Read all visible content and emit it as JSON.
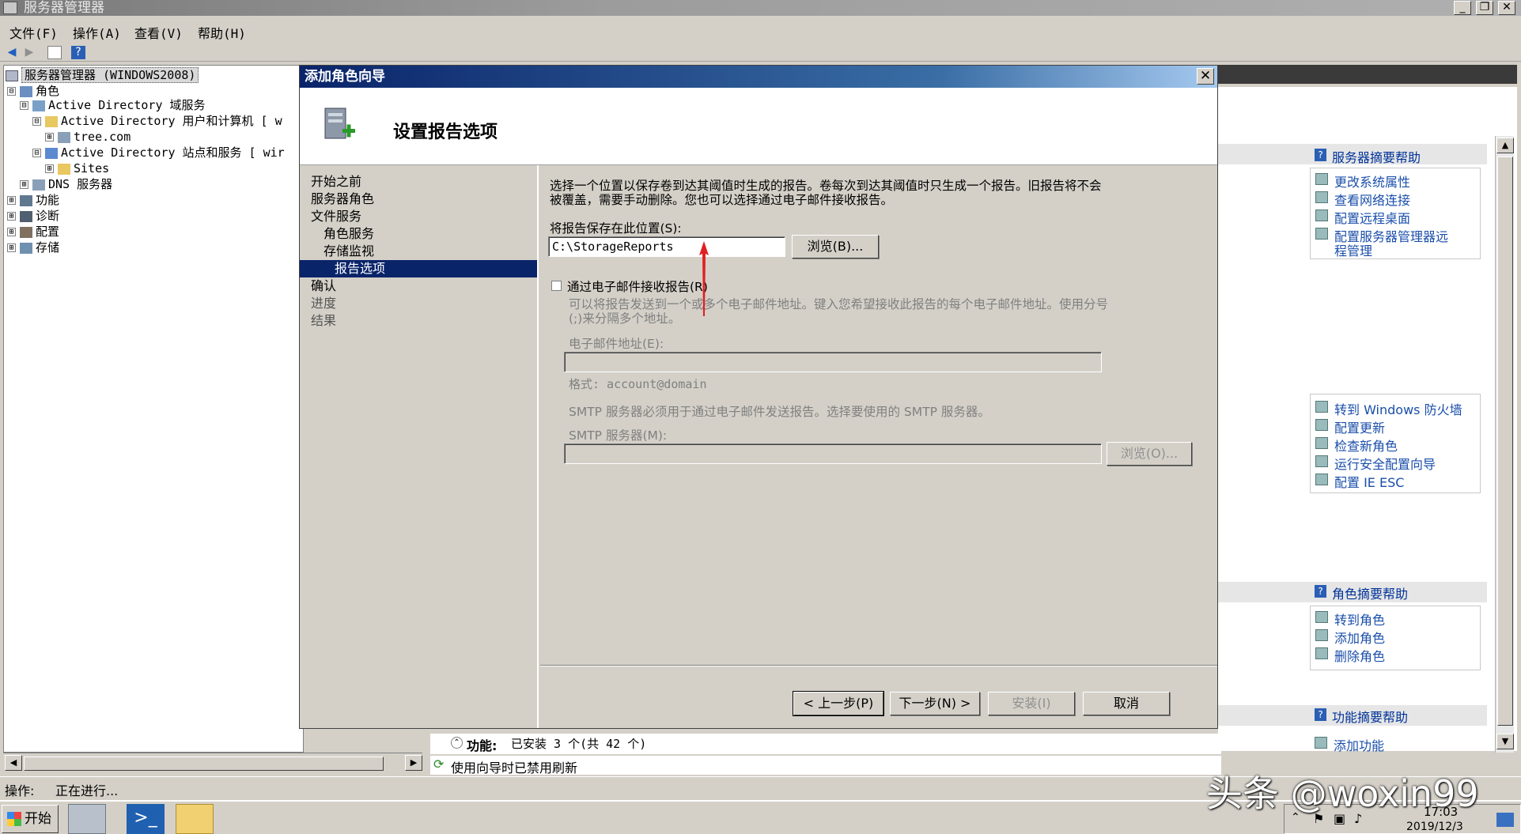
{
  "window": {
    "title": "服务器管理器",
    "min_label": "_",
    "restore_label": "❐",
    "close_label": "✕"
  },
  "menu": [
    "文件(F)",
    "操作(A)",
    "查看(V)",
    "帮助(H)"
  ],
  "tree": {
    "root": "服务器管理器 (WINDOWS2008)",
    "items": [
      {
        "label": "角色",
        "exp": "⊟"
      },
      {
        "label": "Active Directory 域服务",
        "exp": "⊟"
      },
      {
        "label": "Active Directory 用户和计算机 [ w",
        "exp": "⊟"
      },
      {
        "label": "tree.com",
        "exp": "⊞"
      },
      {
        "label": "Active Directory 站点和服务 [ wir",
        "exp": "⊟"
      },
      {
        "label": "Sites",
        "exp": "⊞"
      },
      {
        "label": "DNS 服务器",
        "exp": "⊞"
      },
      {
        "label": "功能",
        "exp": "⊞"
      },
      {
        "label": "诊断",
        "exp": "⊞"
      },
      {
        "label": "配置",
        "exp": "⊞"
      },
      {
        "label": "存储",
        "exp": "⊞"
      }
    ]
  },
  "right_pane": {
    "sections": [
      {
        "header": "服务器摘要帮助",
        "links": [
          "更改系统属性",
          "查看网络连接",
          "配置远程桌面",
          "配置服务器管理器远",
          "程管理"
        ]
      },
      {
        "header": "",
        "links": [
          "转到 Windows 防火墙",
          "配置更新",
          "检查新角色",
          "运行安全配置向导",
          "配置 IE ESC"
        ]
      },
      {
        "header": "角色摘要帮助",
        "links": [
          "转到角色",
          "添加角色",
          "删除角色"
        ]
      },
      {
        "header": "功能摘要帮助",
        "links": [
          "添加功能"
        ]
      }
    ]
  },
  "features_line": {
    "label": "功能:",
    "value": "已安装 3 个(共 42 个)"
  },
  "refresh_note": "使用向导时已禁用刷新",
  "dialog": {
    "title": "添加角色向导",
    "close_label": "✕",
    "header": "设置报告选项",
    "nav": [
      {
        "label": "开始之前",
        "state": "normal"
      },
      {
        "label": "服务器角色",
        "state": "normal"
      },
      {
        "label": "文件服务",
        "state": "normal"
      },
      {
        "label": "角色服务",
        "state": "normal"
      },
      {
        "label": "存储监视",
        "state": "normal"
      },
      {
        "label": "报告选项",
        "state": "current"
      },
      {
        "label": "确认",
        "state": "normal"
      },
      {
        "label": "进度",
        "state": "disabled"
      },
      {
        "label": "结果",
        "state": "disabled"
      }
    ],
    "intro_line1": "选择一个位置以保存卷到达其阈值时生成的报告。卷每次到达其阈值时只生成一个报告。旧报告将不会",
    "intro_line2": "被覆盖，需要手动删除。您也可以选择通过电子邮件接收报告。",
    "save_location_label": "将报告保存在此位置(S):",
    "save_location_value": "C:\\StorageReports",
    "browse_label": "浏览(B)...",
    "email_checkbox_label": "通过电子邮件接收报告(R)",
    "email_desc_line1": "可以将报告发送到一个或多个电子邮件地址。键入您希望接收此报告的每个电子邮件地址。使用分号",
    "email_desc_line2": "(;)来分隔多个地址。",
    "email_label": "电子邮件地址(E):",
    "email_value": "",
    "email_format": "格式: account@domain",
    "smtp_desc": "SMTP 服务器必须用于通过电子邮件发送报告。选择要使用的 SMTP 服务器。",
    "smtp_label": "SMTP 服务器(M):",
    "smtp_value": "",
    "smtp_browse_label": "浏览(O)...",
    "buttons": {
      "prev": "< 上一步(P)",
      "next": "下一步(N) >",
      "install": "安装(I)",
      "cancel": "取消"
    }
  },
  "status_bar": {
    "label": "操作:",
    "value": "正在进行..."
  },
  "taskbar": {
    "start": "开始",
    "time": "17:03",
    "date": "2019/12/3"
  },
  "watermark": "头条 @woxin99"
}
